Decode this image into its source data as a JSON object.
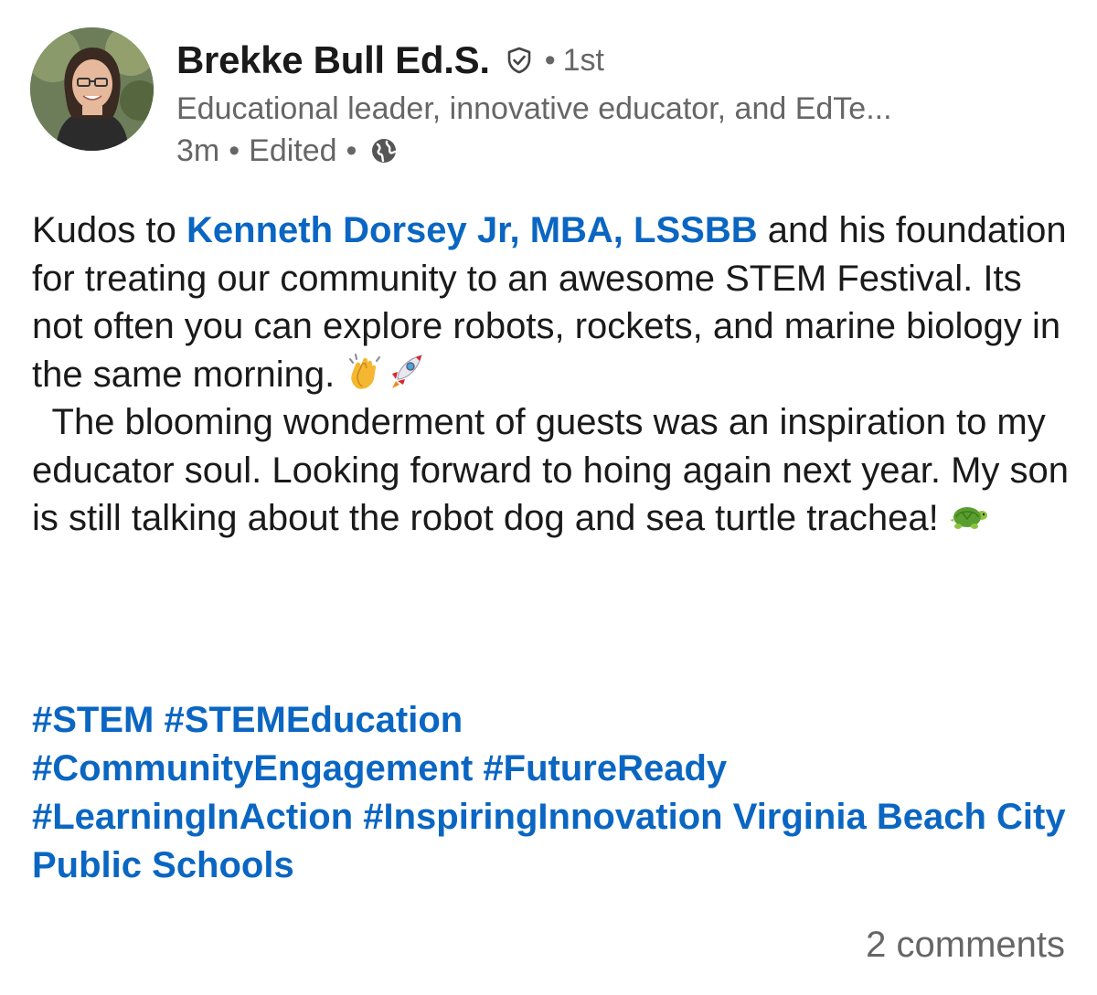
{
  "author": {
    "name": "Brekke Bull Ed.S.",
    "connection_degree": "1st",
    "headline": "Educational leader, innovative educator, and EdTe...",
    "time_ago": "3m",
    "edited_label": "Edited",
    "visibility_icon": "globe-icon",
    "verified_icon": "shield-check-icon"
  },
  "post": {
    "line1_prefix": "Kudos to ",
    "mention": "Kenneth Dorsey Jr, MBA, LSSBB",
    "line1_suffix": " and his foundation for treating our community to an awesome STEM Festival. Its not often you can explore robots, rockets, and marine biology in the same morning. ",
    "emoji_1": "clapping-hands-emoji",
    "emoji_2": "rocket-emoji",
    "paragraph2": "The blooming wonderment of guests was an inspiration to my educator soul. Looking forward to hoing again next year. My son is still talking about the robot dog and sea turtle trachea! ",
    "emoji_3": "turtle-emoji",
    "hashtags": [
      "#STEM",
      "#STEMEducation",
      "#CommunityEngagement",
      "#FutureReady",
      "#LearningInAction",
      "#InspiringInnovation"
    ],
    "trailing_mention": "Virginia Beach City Public Schools"
  },
  "footer": {
    "comments": "2 comments"
  },
  "colors": {
    "link": "#0a66c2",
    "text": "#1a1a1a",
    "muted": "#666666"
  }
}
